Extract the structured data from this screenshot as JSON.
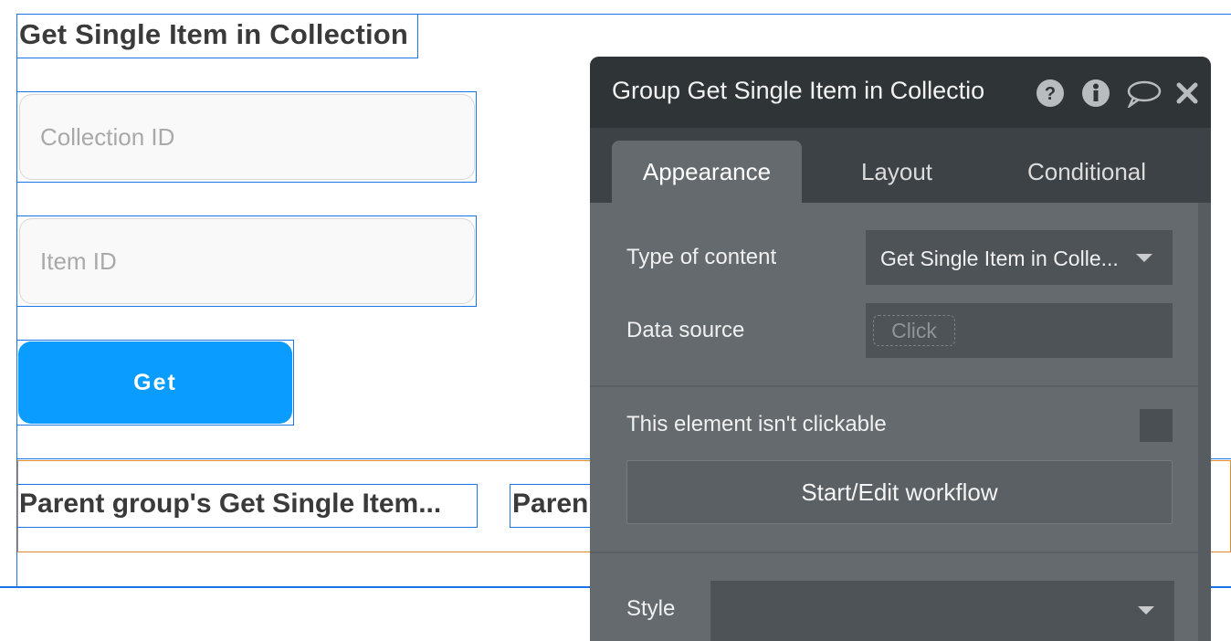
{
  "canvas": {
    "title": "Get Single Item in Collection",
    "collection_input": {
      "value": "",
      "placeholder": "Collection ID"
    },
    "item_input": {
      "value": "",
      "placeholder": "Item ID"
    },
    "get_button": "Get",
    "repeating_group": {
      "cell1": "Parent group's Get Single Item...",
      "cell2": "Paren"
    }
  },
  "property_editor": {
    "title": "Group Get Single Item in Collectio",
    "icons": [
      "help-icon",
      "info-icon",
      "comment-icon",
      "close-icon"
    ],
    "tabs": [
      {
        "label": "Appearance",
        "active": true
      },
      {
        "label": "Layout",
        "active": false
      },
      {
        "label": "Conditional",
        "active": false
      }
    ],
    "type_of_content": {
      "label": "Type of content",
      "value": "Get Single Item in Colle..."
    },
    "data_source": {
      "label": "Data source",
      "placeholder": "Click"
    },
    "not_clickable": {
      "label": "This element isn't clickable",
      "checked": false
    },
    "workflow_button": "Start/Edit workflow",
    "style": {
      "label": "Style",
      "value": ""
    }
  },
  "colors": {
    "selection": "#1a73e8",
    "button": "#0b9cff",
    "panel_header": "#2f3437",
    "panel_body": "#656a6e",
    "repeating_group_outline": "#e08a2c"
  }
}
